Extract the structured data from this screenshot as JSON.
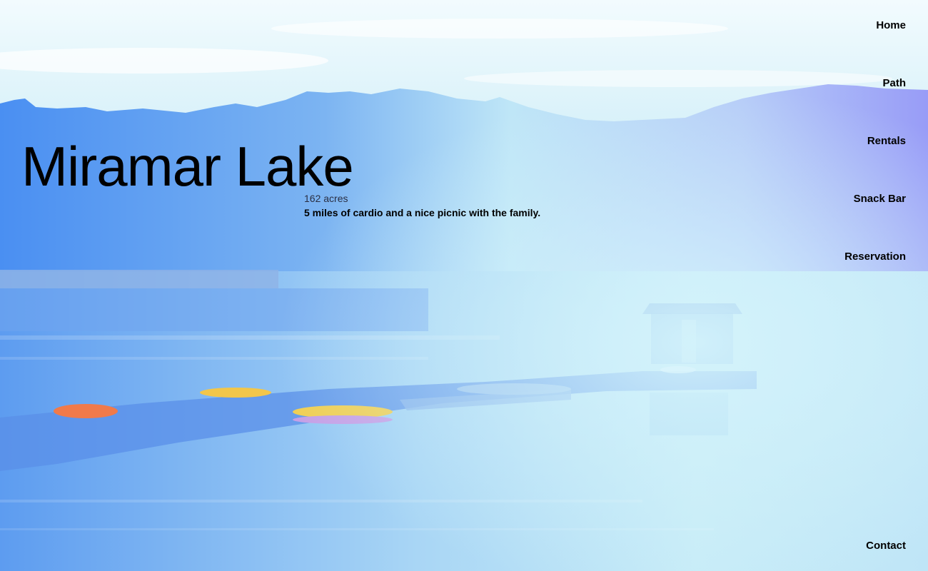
{
  "hero": {
    "title": "Miramar Lake",
    "acres": "162 acres",
    "tagline": "5 miles of cardio and a nice picnic with the family."
  },
  "nav": {
    "home": "Home",
    "path": "Path",
    "rentals": "Rentals",
    "snack_bar": "Snack Bar",
    "reservation": "Reservation"
  },
  "footer": {
    "contact": "Contact"
  },
  "colors": {
    "sky": "#e6f7fb",
    "water_blue": "#4f93f0",
    "haze": "#bfe8f6",
    "violet": "#9a9cf5"
  }
}
